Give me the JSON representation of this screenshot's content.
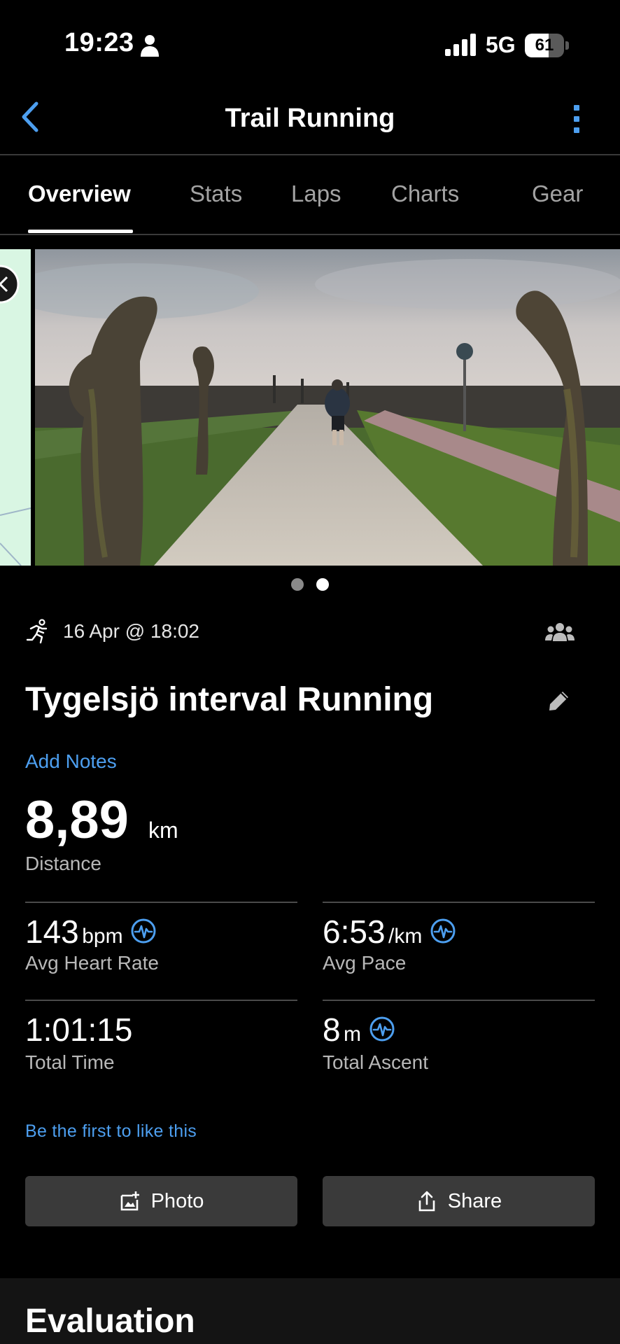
{
  "status_bar": {
    "time": "19:23",
    "network": "5G",
    "battery": "61",
    "battery_level_percent": 61
  },
  "nav": {
    "title": "Trail Running"
  },
  "tabs": [
    {
      "label": "Overview",
      "active": true
    },
    {
      "label": "Stats"
    },
    {
      "label": "Laps"
    },
    {
      "label": "Charts"
    },
    {
      "label": "Gear"
    }
  ],
  "carousel": {
    "pages": 2,
    "active_page": 2
  },
  "activity": {
    "date": "16 Apr @ 18:02",
    "title": "Tygelsjö interval Running",
    "add_notes": "Add Notes"
  },
  "distance": {
    "value": "8,89",
    "unit": "km",
    "label": "Distance"
  },
  "stats": [
    {
      "value": "143",
      "unit": "bpm",
      "label": "Avg Heart Rate"
    },
    {
      "value": "6:53",
      "unit": "/km",
      "label": "Avg Pace"
    },
    {
      "value": "1:01:15",
      "unit": "",
      "label": "Total Time"
    },
    {
      "value": "8",
      "unit": "m",
      "label": "Total Ascent"
    }
  ],
  "like_text": "Be the first to like this",
  "buttons": {
    "photo": "Photo",
    "share": "Share"
  },
  "evaluation": {
    "title": "Evaluation"
  },
  "colors": {
    "accent": "#4d9ff0",
    "background": "#000000",
    "button_bg": "#3a3a3a"
  },
  "icons": [
    "person-icon",
    "signal-icon",
    "battery-icon",
    "back-chevron-icon",
    "more-vertical-icon",
    "running-icon",
    "group-icon",
    "pencil-icon",
    "heart-wave-icon",
    "add-photo-icon",
    "share-icon"
  ]
}
